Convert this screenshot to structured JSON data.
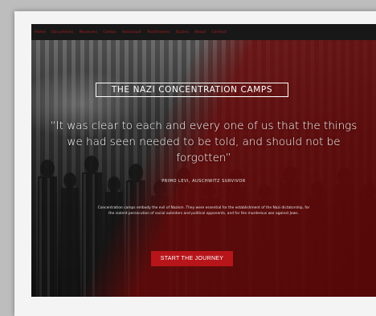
{
  "nav": {
    "items": [
      {
        "label": "Home"
      },
      {
        "label": "Documents"
      },
      {
        "label": "Museums"
      },
      {
        "label": "Camps"
      },
      {
        "label": "Holocaust"
      },
      {
        "label": "Testimonies"
      },
      {
        "label": "Quizes"
      },
      {
        "label": "About"
      },
      {
        "label": "Contact"
      }
    ]
  },
  "hero": {
    "title": "THE NAZI CONCENTRATION CAMPS",
    "quote": "“It was clear to each and every one of us that the things we had seen needed to be told, and should not be forgotten”",
    "attribution": "PRIMO LEVI, AUSCHWITZ SURVIVOR",
    "body": "Concentration camps embody the evil of Nazism. They were essential for the establishment of the Nazi dictatorship, for the violent persecution of social outsiders and political opponents, and for the murderous war against Jews.",
    "cta_label": "START THE JOURNEY"
  },
  "colors": {
    "accent": "#b7151a",
    "nav_text": "#b31e1e",
    "overlay_red": "#6e0808"
  }
}
